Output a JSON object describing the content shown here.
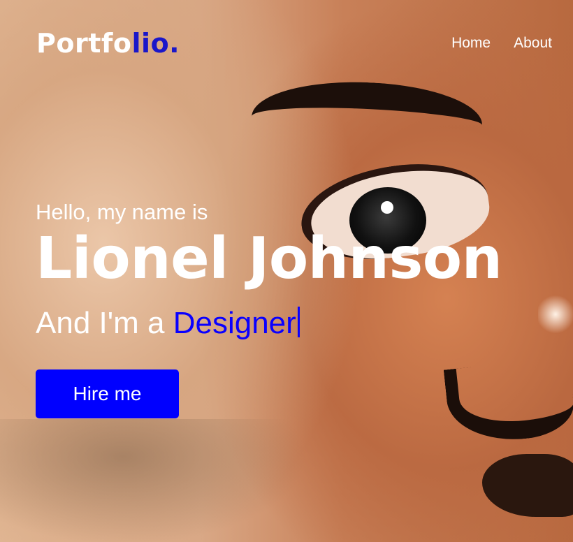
{
  "header": {
    "logo_main": "Portfo",
    "logo_accent": "lio.",
    "nav": [
      {
        "label": "Home"
      },
      {
        "label": "About"
      }
    ]
  },
  "hero": {
    "greeting": "Hello, my name is",
    "name": "Lionel Johnson",
    "tagline_prefix": "And I'm a ",
    "role": "Designer",
    "cta_label": "Hire me"
  },
  "colors": {
    "accent": "#0000ff",
    "logo_accent": "#1a17c9",
    "text": "#ffffff"
  }
}
